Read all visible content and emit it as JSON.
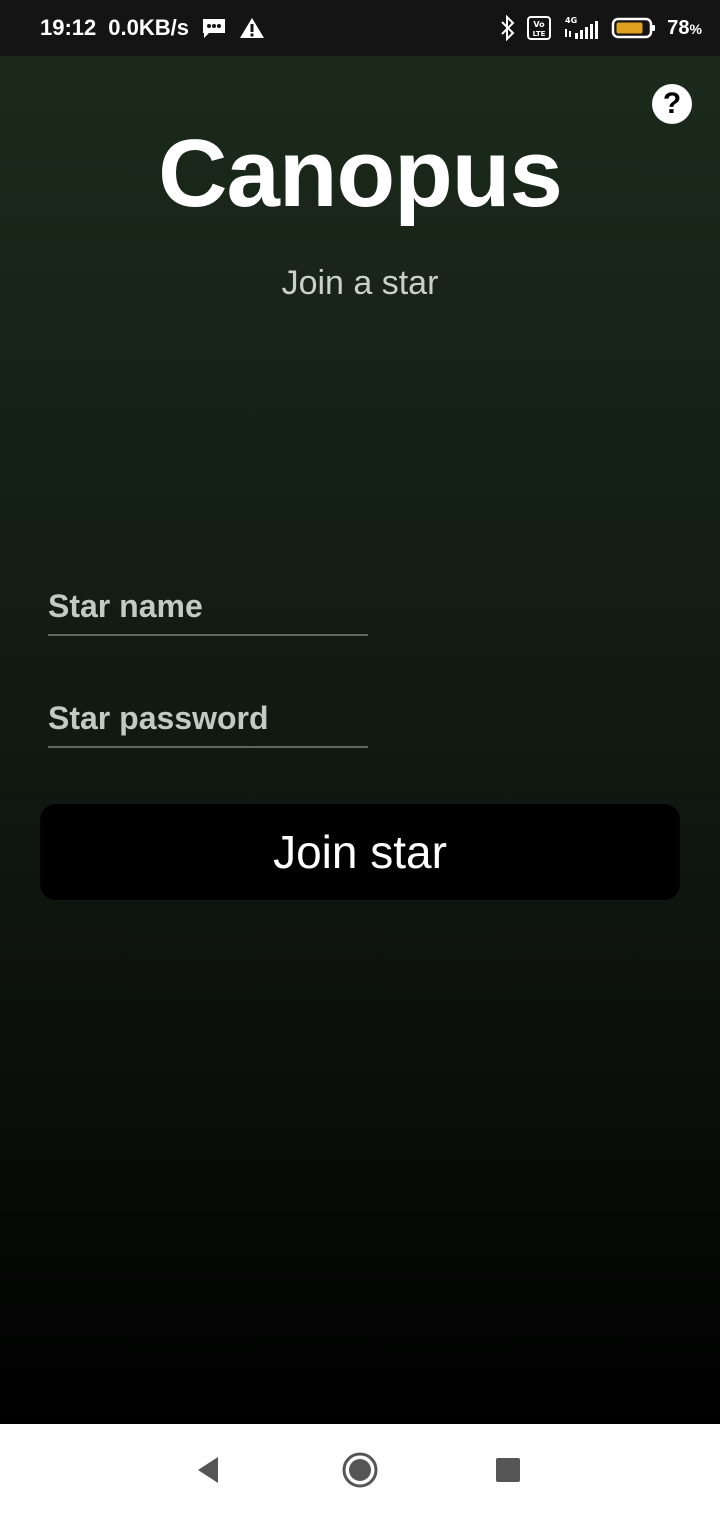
{
  "status_bar": {
    "time": "19:12",
    "network_speed": "0.0KB/s",
    "network_type": "4G",
    "volte_label": "Vo LTE",
    "battery_percent": "78",
    "battery_symbol": "%",
    "icons": [
      "message-icon",
      "warning-icon",
      "bluetooth-icon",
      "volte-icon",
      "signal-icon",
      "battery-icon"
    ],
    "battery_color": "#e0a020"
  },
  "app": {
    "title": "Canopus",
    "subtitle": "Join a star",
    "help_label": "?",
    "background_top": "#1b2a1b",
    "background_bottom": "#000000"
  },
  "form": {
    "star_name": {
      "value": "",
      "placeholder": "Star name"
    },
    "star_password": {
      "value": "",
      "placeholder": "Star password"
    },
    "join_button_label": "Join star"
  },
  "nav_bar": {
    "icons": [
      "back-icon",
      "home-icon",
      "recents-icon"
    ]
  }
}
